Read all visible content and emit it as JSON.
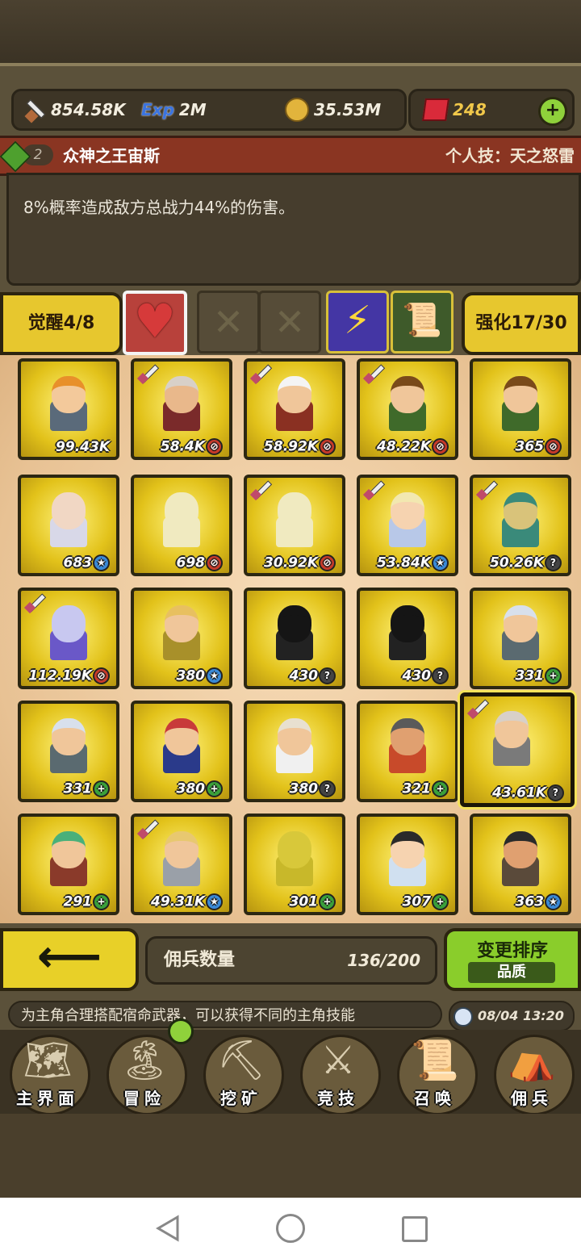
{
  "resources": {
    "attack": "854.58K",
    "exp_label": "Exp",
    "exp": "2M",
    "gold": "35.53M",
    "gems": "248"
  },
  "skill": {
    "level": "2",
    "hero_name": "众神之王宙斯",
    "skill_label": "个人技：天之怒雷",
    "description": "8%概率造成敌方总战力44%的伤害。"
  },
  "awaken": {
    "label": "觉醒4/8"
  },
  "enhance": {
    "label": "强化17/30"
  },
  "heroes": [
    {
      "value": "99.43K",
      "icon": "",
      "sword": false,
      "hair": "#e8902a",
      "skin": "#f3c99b",
      "clothes": "#5a6a7a"
    },
    {
      "value": "58.4K",
      "icon": "no",
      "sword": true,
      "hair": "#d8d0c8",
      "skin": "#e9b88b",
      "clothes": "#7a2a2a"
    },
    {
      "value": "58.92K",
      "icon": "no",
      "sword": true,
      "hair": "#f4f4f4",
      "skin": "#f0c69a",
      "clothes": "#8a3022"
    },
    {
      "value": "48.22K",
      "icon": "no",
      "sword": true,
      "hair": "#7a4a1a",
      "skin": "#f0c69a",
      "clothes": "#3f6a2a"
    },
    {
      "value": "365",
      "icon": "no",
      "sword": false,
      "hair": "#7a4a1a",
      "skin": "#f0c69a",
      "clothes": "#3f6a2a"
    },
    {
      "value": "683",
      "icon": "star",
      "sword": false,
      "hair": "#f1d7c4",
      "skin": "#f1d7c4",
      "clothes": "#d8d8e8"
    },
    {
      "value": "698",
      "icon": "no",
      "sword": false,
      "hair": "#f0eac0",
      "skin": "#f0eac0",
      "clothes": "#f0eac0"
    },
    {
      "value": "30.92K",
      "icon": "no",
      "sword": true,
      "hair": "#f0eac0",
      "skin": "#f0eac0",
      "clothes": "#f0eac0"
    },
    {
      "value": "53.84K",
      "icon": "star",
      "sword": true,
      "hair": "#f2e8b0",
      "skin": "#f6d3b0",
      "clothes": "#b8c8e8"
    },
    {
      "value": "50.26K",
      "icon": "q",
      "sword": true,
      "hair": "#3a8a7a",
      "skin": "#d9c37a",
      "clothes": "#3a8a7a"
    },
    {
      "value": "112.19K",
      "icon": "no",
      "sword": true,
      "hair": "#c8c8f0",
      "skin": "#c8c8f0",
      "clothes": "#6a58c8"
    },
    {
      "value": "380",
      "icon": "star",
      "sword": false,
      "hair": "#e8c060",
      "skin": "#f0c69a",
      "clothes": "#a8902a"
    },
    {
      "value": "430",
      "icon": "q",
      "sword": false,
      "hair": "#151515",
      "skin": "#151515",
      "clothes": "#222"
    },
    {
      "value": "430",
      "icon": "q",
      "sword": false,
      "hair": "#151515",
      "skin": "#151515",
      "clothes": "#222"
    },
    {
      "value": "331",
      "icon": "plus",
      "sword": false,
      "hair": "#d8e0ec",
      "skin": "#f0c69a",
      "clothes": "#5a6a70"
    },
    {
      "value": "331",
      "icon": "plus",
      "sword": false,
      "hair": "#d8e0ec",
      "skin": "#f0c69a",
      "clothes": "#5a6a70"
    },
    {
      "value": "380",
      "icon": "plus",
      "sword": false,
      "hair": "#c83a3a",
      "skin": "#f0c69a",
      "clothes": "#2a3a8a"
    },
    {
      "value": "380",
      "icon": "q",
      "sword": false,
      "hair": "#e8e0d0",
      "skin": "#f0c69a",
      "clothes": "#f0f0f0"
    },
    {
      "value": "321",
      "icon": "plus",
      "sword": false,
      "hair": "#5a5a5a",
      "skin": "#e0a070",
      "clothes": "#c84a2a"
    },
    {
      "value": "43.61K",
      "icon": "q",
      "sword": true,
      "hair": "#d8d0c8",
      "skin": "#f0c69a",
      "clothes": "#7a7a7a"
    },
    {
      "value": "291",
      "icon": "plus",
      "sword": false,
      "hair": "#4ab07a",
      "skin": "#f0c69a",
      "clothes": "#8a3a2a"
    },
    {
      "value": "49.31K",
      "icon": "star",
      "sword": true,
      "hair": "#e8c870",
      "skin": "#f0c69a",
      "clothes": "#9aa0a8"
    },
    {
      "value": "301",
      "icon": "plus",
      "sword": false,
      "hair": "#d8c83a",
      "skin": "#d8c83a",
      "clothes": "#c8b82a"
    },
    {
      "value": "307",
      "icon": "plus",
      "sword": false,
      "hair": "#2a2a2a",
      "skin": "#f6d3b0",
      "clothes": "#d0e0f0"
    },
    {
      "value": "363",
      "icon": "star",
      "sword": false,
      "hair": "#2a2a2a",
      "skin": "#e0a070",
      "clothes": "#5a4a3a"
    }
  ],
  "bottom": {
    "mercenary_count_label": "佣兵数量",
    "mercenary_count": "136/200",
    "sort_label": "变更排序",
    "sort_value": "品质"
  },
  "ticker": "为主角合理搭配宿命武器，可以获得不同的主角技能",
  "clock": "08/04 13:20",
  "nav": [
    {
      "label": "主界面",
      "icon": "map-icon",
      "glyph": "🗺"
    },
    {
      "label": "冒险",
      "icon": "island-icon",
      "glyph": "🏝"
    },
    {
      "label": "挖矿",
      "icon": "pickaxe-icon",
      "glyph": "⛏"
    },
    {
      "label": "竞技",
      "icon": "crossed-swords-icon",
      "glyph": "⚔"
    },
    {
      "label": "召唤",
      "icon": "scroll-icon",
      "glyph": "📜"
    },
    {
      "label": "佣兵",
      "icon": "tent-icon",
      "glyph": "⛺"
    }
  ]
}
